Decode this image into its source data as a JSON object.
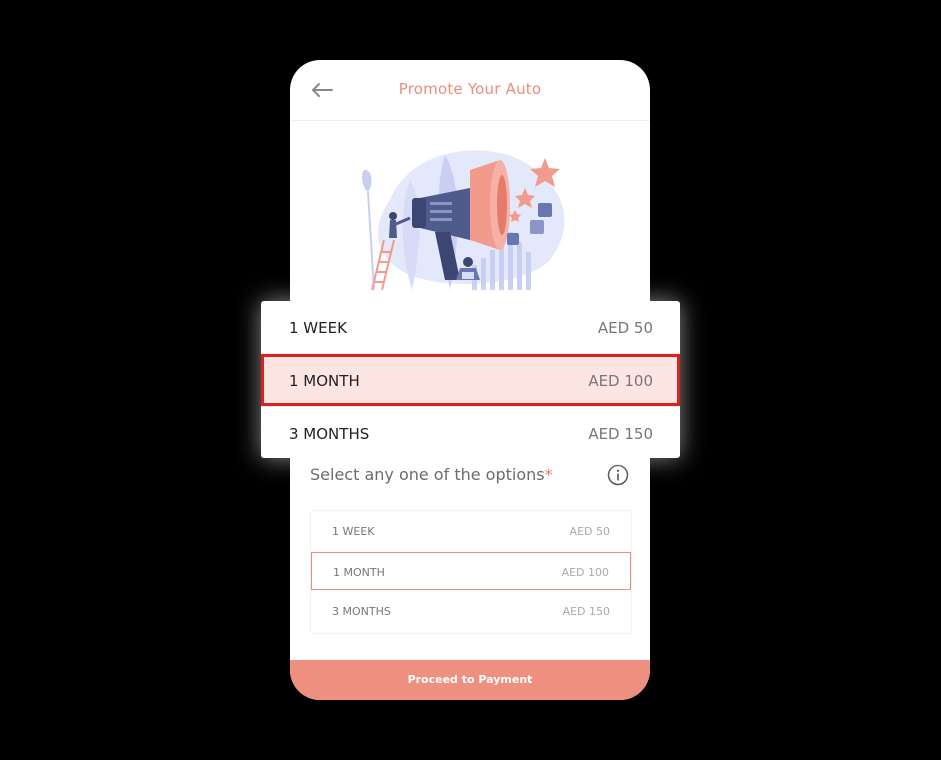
{
  "header": {
    "title": "Promote Your Auto"
  },
  "selector": {
    "label": "Select any one of the options",
    "required_mark": "*"
  },
  "options": [
    {
      "label": "1 WEEK",
      "price": "AED 50"
    },
    {
      "label": "1 MONTH",
      "price": "AED 100"
    },
    {
      "label": "3 MONTHS",
      "price": "AED 150"
    }
  ],
  "selected_index": 1,
  "dropdown": {
    "options": [
      {
        "label": "1 WEEK",
        "price": "AED 50"
      },
      {
        "label": "1 MONTH",
        "price": "AED 100"
      },
      {
        "label": "3 MONTHS",
        "price": "AED 150"
      }
    ]
  },
  "proceed_label": "Proceed to Payment",
  "icons": {
    "back": "arrow-left-icon",
    "info": "info-icon",
    "illustration": "megaphone-illustration"
  },
  "colors": {
    "accent": "#ec8d7d",
    "button": "#ef8f7f",
    "highlight_border": "#d8241e",
    "highlight_fill": "#fde5e3",
    "illustration_blue": "#c9cff3"
  }
}
